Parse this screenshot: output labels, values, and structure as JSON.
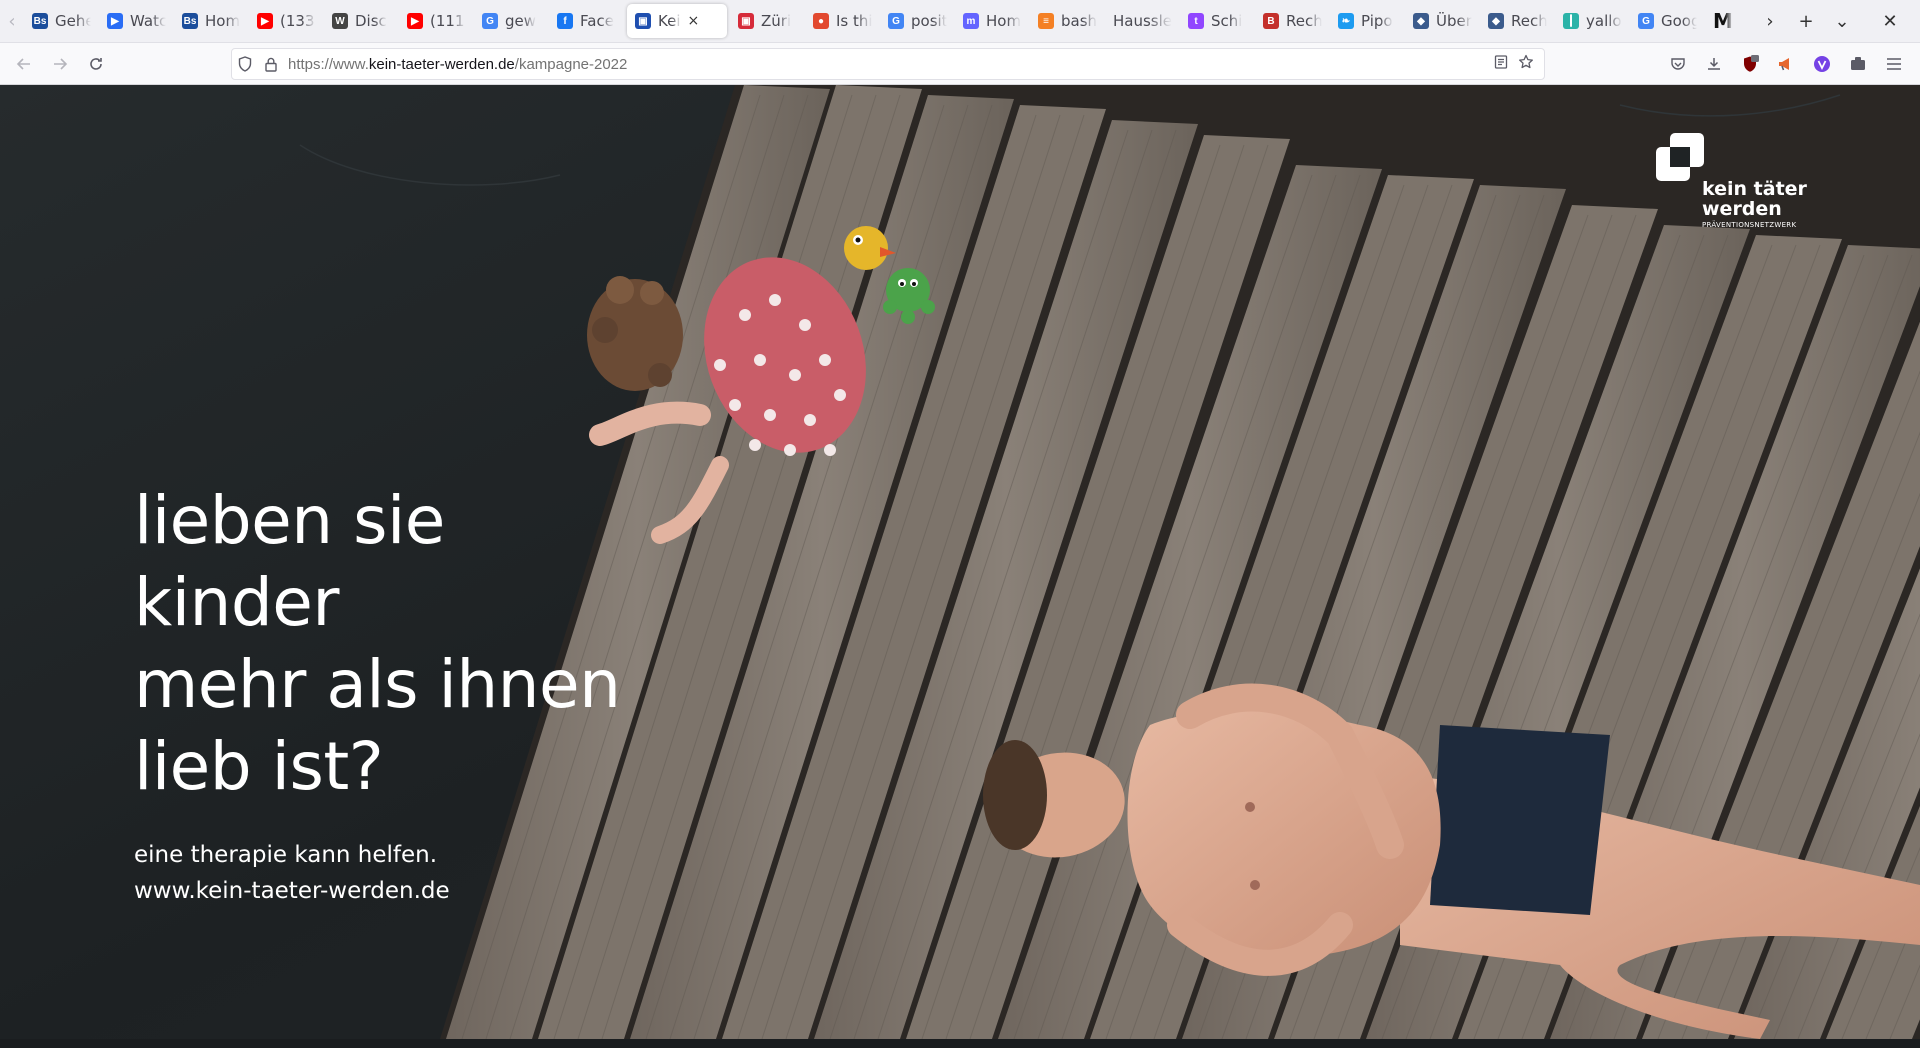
{
  "browser": {
    "tabs": [
      {
        "title": "Gehe",
        "fav": "Bs",
        "color": "#1c4e9c"
      },
      {
        "title": "Watc",
        "fav": "▶",
        "color": "#2a6df5"
      },
      {
        "title": "Hom",
        "fav": "Bs",
        "color": "#1c4e9c"
      },
      {
        "title": "(133)",
        "fav": "▶",
        "color": "#ff0000"
      },
      {
        "title": "Disc",
        "fav": "W",
        "color": "#444444"
      },
      {
        "title": "(111)",
        "fav": "▶",
        "color": "#ff0000"
      },
      {
        "title": "gew",
        "fav": "G",
        "color": "#4285f4"
      },
      {
        "title": "Face",
        "fav": "f",
        "color": "#1877f2"
      },
      {
        "title": "Kei",
        "fav": "▣",
        "color": "#1f4fb0",
        "active": true
      },
      {
        "title": "Züri",
        "fav": "▣",
        "color": "#d62b3a"
      },
      {
        "title": "Is thi",
        "fav": "●",
        "color": "#e2492f"
      },
      {
        "title": "posit",
        "fav": "G",
        "color": "#4285f4"
      },
      {
        "title": "Hom",
        "fav": "m",
        "color": "#6364ff"
      },
      {
        "title": "bash",
        "fav": "≡",
        "color": "#f48024"
      },
      {
        "title": "Haussle",
        "fav": "",
        "color": "#f0f0f4"
      },
      {
        "title": "Schi",
        "fav": "t",
        "color": "#9146ff"
      },
      {
        "title": "Rech",
        "fav": "B",
        "color": "#c4302b"
      },
      {
        "title": "Pipo",
        "fav": "❧",
        "color": "#1d9bf0"
      },
      {
        "title": "Über",
        "fav": "◆",
        "color": "#3b5b8c"
      },
      {
        "title": "Rech",
        "fav": "◆",
        "color": "#3b5b8c"
      },
      {
        "title": "yallo",
        "fav": "┃",
        "color": "#2bb3a8"
      },
      {
        "title": "Goog",
        "fav": "G",
        "color": "#4285f4"
      },
      {
        "title": "M",
        "fav": "",
        "color": "#f0f0f4"
      }
    ],
    "close_tab_symbol": "×",
    "url": {
      "prefix": "https://www.",
      "host": "kein-taeter-werden.de",
      "path": "/kampagne-2022"
    }
  },
  "campaign": {
    "headline": [
      "lieben sie",
      "kinder",
      "mehr als ihnen",
      "lieb ist?"
    ],
    "subline": "eine therapie kann helfen.",
    "website": "www.kein-taeter-werden.de",
    "logo": {
      "line1": "kein täter",
      "line2": "werden",
      "line3": "PRÄVENTIONSNETZWERK"
    }
  },
  "colors": {
    "water": "#1f2325",
    "plank": "#7d746b",
    "plank_dark": "#5f5851",
    "text": "#ffffff"
  },
  "icons": {
    "back": "arrow-left-icon",
    "forward": "arrow-right-icon",
    "reload": "reload-icon",
    "shield": "shield-icon",
    "lock": "lock-icon",
    "reader": "reader-view-icon",
    "bookmark": "star-icon",
    "pocket": "pocket-icon",
    "download": "download-icon",
    "menu": "hamburger-menu-icon"
  }
}
